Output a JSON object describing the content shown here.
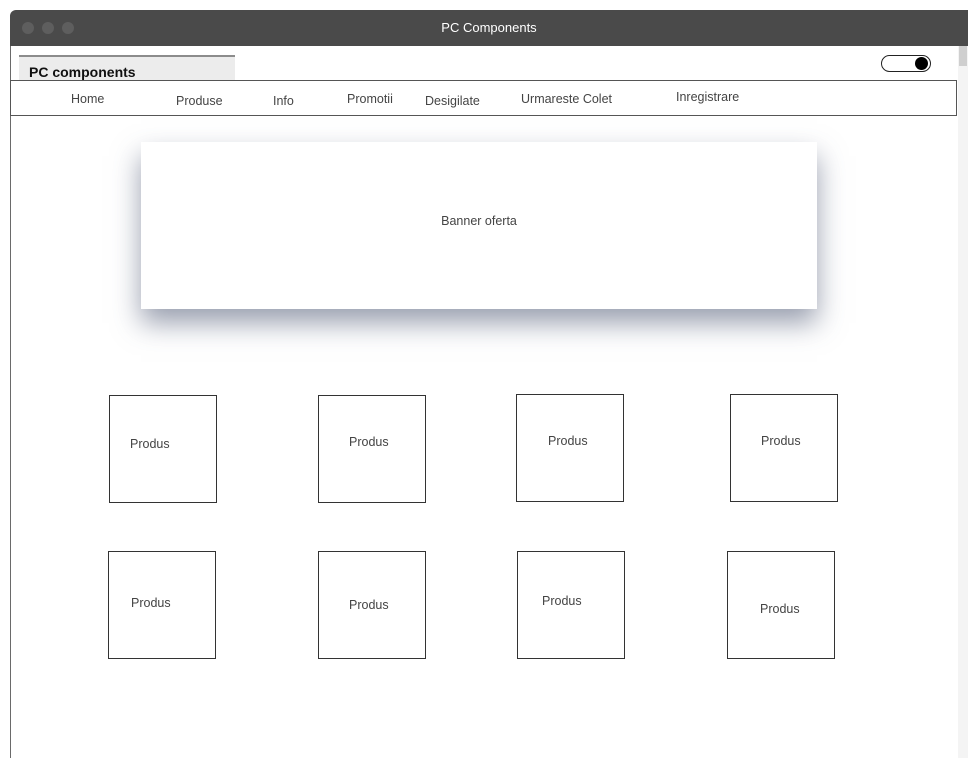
{
  "window": {
    "title": "PC Components"
  },
  "header": {
    "brand": "PC components",
    "theme_toggle": "on"
  },
  "nav": {
    "items": [
      {
        "label": "Home"
      },
      {
        "label": "Produse"
      },
      {
        "label": "Info"
      },
      {
        "label": "Promotii"
      },
      {
        "label": "Desigilate"
      },
      {
        "label": "Urmareste Colet"
      },
      {
        "label": "Inregistrare"
      }
    ]
  },
  "banner": {
    "label": "Banner oferta"
  },
  "products": [
    {
      "label": "Produs"
    },
    {
      "label": "Produs"
    },
    {
      "label": "Produs"
    },
    {
      "label": "Produs"
    },
    {
      "label": "Produs"
    },
    {
      "label": "Produs"
    },
    {
      "label": "Produs"
    },
    {
      "label": "Produs"
    }
  ],
  "colors": {
    "titlebar": "#4a4a4a",
    "border": "#333333",
    "shadow": "#46506e"
  }
}
